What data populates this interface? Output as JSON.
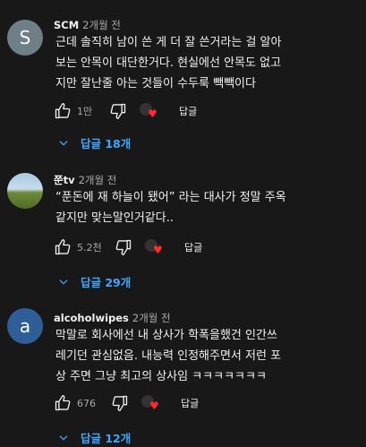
{
  "comments": [
    {
      "author": "SCM",
      "time": "2개월 전",
      "avatar_letter": "S",
      "lines": [
        "근데 솔직히 남이 쓴 게 더 잘 쓴거라는 걸 알아",
        "보는 안목이 대단한거다. 현실에선 안목도 없고",
        "지만 잘난줄 아는 것들이 수두룩 빽빽이다"
      ],
      "likes": "1만",
      "reply_label": "답글",
      "replies_label": "답글 18개"
    },
    {
      "author": "쭌tv",
      "time": "2개월 전",
      "lines": [
        "“푼돈에 재 하늘이 됐어” 라는 대사가 정말 주옥",
        "같지만 맞는말인거같다.."
      ],
      "likes": "5.2천",
      "reply_label": "답글",
      "replies_label": "답글 29개"
    },
    {
      "author": "alcoholwipes",
      "time": "2개월 전",
      "avatar_letter": "a",
      "lines": [
        "막말로 회사에선 내 상사가 학폭을했건 인간쓰",
        "레기던 관심없음. 내능력 인정해주면서 저런 포",
        "상 주면 그냥 최고의 상사임 ㅋㅋㅋㅋㅋㅋㅋ"
      ],
      "likes": "676",
      "reply_label": "답글",
      "replies_label": "답글 12개"
    }
  ],
  "icons": {
    "like": "thumb-up-icon",
    "dislike": "thumb-down-icon",
    "creator_heart": "creator-heart-icon",
    "expand": "chevron-down-icon"
  },
  "colors": {
    "background": "#181818",
    "link": "#3ea6ff",
    "heart": "#ff2a2a"
  }
}
